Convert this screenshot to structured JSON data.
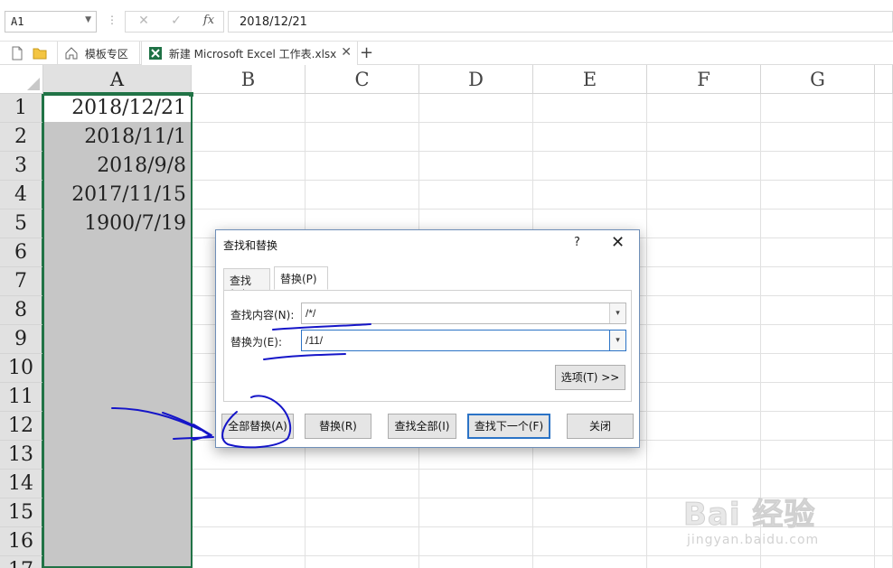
{
  "formula_bar": {
    "name_box": "A1",
    "cancel_icon": "✕",
    "confirm_icon": "✓",
    "fx_icon": "fx",
    "formula_value": "2018/12/21"
  },
  "tabs": {
    "template_tab": "模板专区",
    "workbook_tab": "新建 Microsoft Excel 工作表.xlsx",
    "add": "+"
  },
  "grid": {
    "columns": [
      "A",
      "B",
      "C",
      "D",
      "E",
      "F",
      "G"
    ],
    "rows": [
      "1",
      "2",
      "3",
      "4",
      "5",
      "6",
      "7",
      "8",
      "9",
      "10",
      "11",
      "12",
      "13",
      "14",
      "15",
      "16",
      "17"
    ],
    "column_a_values": [
      "2018/12/21",
      "2018/11/1",
      "2018/9/8",
      "2017/11/15",
      "1900/7/19"
    ]
  },
  "dialog": {
    "title": "查找和替换",
    "help": "?",
    "close": "✕",
    "tab_find": "查找(D)",
    "tab_replace": "替换(P)",
    "find_label": "查找内容(N):",
    "find_value": "/*/",
    "replace_label": "替换为(E):",
    "replace_value": "/11/",
    "options_button": "选项(T) >>",
    "replace_all_button": "全部替换(A)",
    "replace_button": "替换(R)",
    "find_all_button": "查找全部(I)",
    "find_next_button": "查找下一个(F)",
    "close_button": "关闭"
  },
  "watermark": {
    "brand": "Bai 经验",
    "url": "jingyan.baidu.com"
  },
  "colors": {
    "selection_green": "#217346",
    "selected_fill": "#c6c6c6",
    "annotation_blue": "#1515c8",
    "focus_blue": "#2b73c6"
  }
}
